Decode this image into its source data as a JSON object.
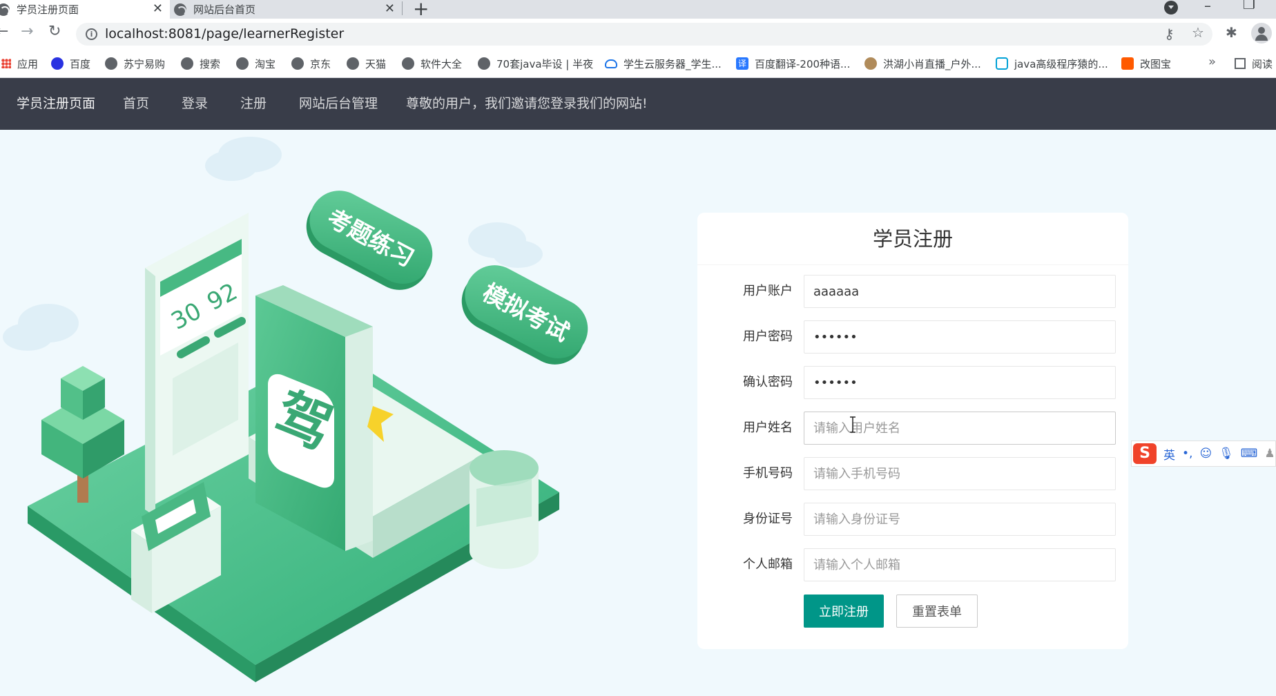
{
  "browser": {
    "tabs": [
      {
        "title": "学员注册页面",
        "active": true
      },
      {
        "title": "网站后台首页",
        "active": false
      }
    ],
    "url": {
      "host": "localhost",
      "rest": ":8081/page/learnerRegister"
    },
    "bookmarks": [
      {
        "label": "应用",
        "icon": "apps-icon"
      },
      {
        "label": "百度",
        "icon": "baidu-icon"
      },
      {
        "label": "苏宁易购",
        "icon": "globe-icon"
      },
      {
        "label": "搜索",
        "icon": "globe-icon"
      },
      {
        "label": "淘宝",
        "icon": "globe-icon"
      },
      {
        "label": "京东",
        "icon": "globe-icon"
      },
      {
        "label": "天猫",
        "icon": "globe-icon"
      },
      {
        "label": "软件大全",
        "icon": "globe-icon"
      },
      {
        "label": "70套java毕设 | 半夜",
        "icon": "globe-icon"
      },
      {
        "label": "学生云服务器_学生...",
        "icon": "cloud-icon"
      },
      {
        "label": "百度翻译-200种语...",
        "icon": "fanyi-icon"
      },
      {
        "label": "洪湖小肖直播_户外...",
        "icon": "bird-icon"
      },
      {
        "label": "java高级程序猿的...",
        "icon": "bilibili-icon"
      },
      {
        "label": "改图宝",
        "icon": "gaitu-icon"
      }
    ],
    "more": "»",
    "reader": "阅读"
  },
  "nav": {
    "brand": "学员注册页面",
    "items": [
      "首页",
      "登录",
      "注册",
      "网站后台管理"
    ],
    "welcome": "尊敬的用户，我们邀请您登录我们的网站!"
  },
  "hero": {
    "badge1": "考题练习",
    "badge2": "模拟考试",
    "book_char": "驾",
    "score1": "30",
    "score2": "92"
  },
  "form": {
    "title": "学员注册",
    "fields": [
      {
        "label": "用户账户",
        "value": "aaaaaa",
        "placeholder": ""
      },
      {
        "label": "用户密码",
        "value": "••••••",
        "placeholder": ""
      },
      {
        "label": "确认密码",
        "value": "••••••",
        "placeholder": ""
      },
      {
        "label": "用户姓名",
        "value": "",
        "placeholder": "请输入用户姓名"
      },
      {
        "label": "手机号码",
        "value": "",
        "placeholder": "请输入手机号码"
      },
      {
        "label": "身份证号",
        "value": "",
        "placeholder": "请输入身份证号"
      },
      {
        "label": "个人邮箱",
        "value": "",
        "placeholder": "请输入个人邮箱"
      }
    ],
    "submit": "立即注册",
    "reset": "重置表单"
  },
  "ime": {
    "logo": "S",
    "mode": "英"
  },
  "colors": {
    "accent": "#009688",
    "nav_bg": "#393d49",
    "page_bg": "#f0f9fd",
    "hero_green": "#3fb883"
  }
}
